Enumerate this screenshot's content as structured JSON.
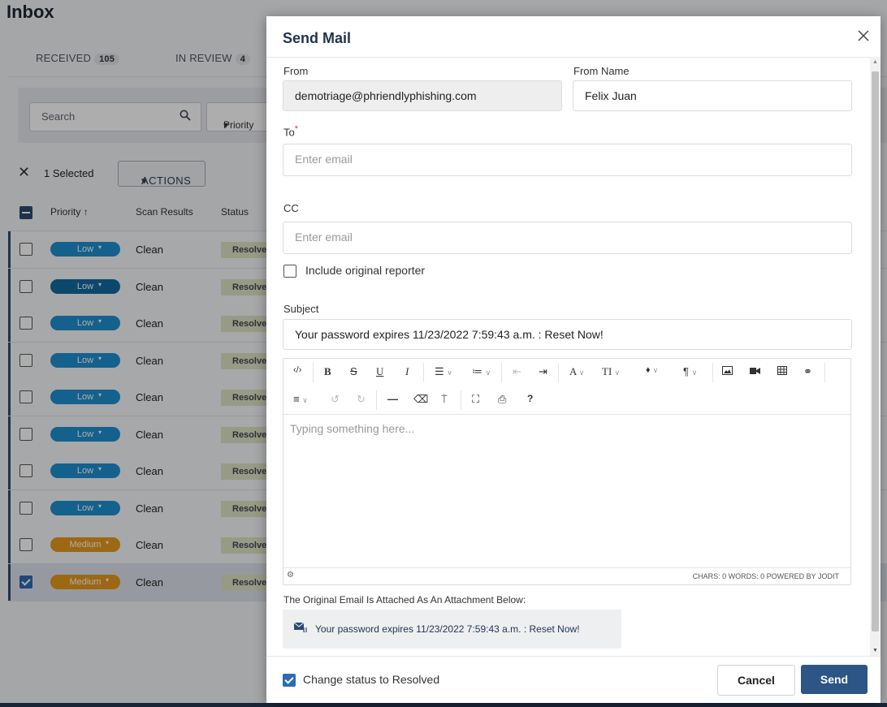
{
  "background": {
    "title": "Inbox",
    "tabs": [
      {
        "label": "RECEIVED",
        "count": "105"
      },
      {
        "label": "IN REVIEW",
        "count": "4"
      }
    ],
    "search_placeholder": "Search",
    "priority_filter": "Priority",
    "selection": {
      "label": "1 Selected",
      "actions": "ACTIONS"
    },
    "columns": [
      "Priority",
      "Scan Results",
      "Status"
    ],
    "rows": [
      {
        "priority": "Low",
        "scan": "Clean",
        "status": "Resolved"
      },
      {
        "priority": "Low",
        "scan": "Clean",
        "status": "Resolved"
      },
      {
        "priority": "Low",
        "scan": "Clean",
        "status": "Resolved"
      },
      {
        "priority": "Low",
        "scan": "Clean",
        "status": "Resolved"
      },
      {
        "priority": "Low",
        "scan": "Clean",
        "status": "Resolved"
      },
      {
        "priority": "Low",
        "scan": "Clean",
        "status": "Resolved"
      },
      {
        "priority": "Low",
        "scan": "Clean",
        "status": "Resolved"
      },
      {
        "priority": "Low",
        "scan": "Clean",
        "status": "Resolved"
      },
      {
        "priority": "Medium",
        "scan": "Clean",
        "status": "Resolved"
      },
      {
        "priority": "Medium",
        "scan": "Clean",
        "status": "Resolved"
      }
    ]
  },
  "modal": {
    "title": "Send Mail",
    "from_label": "From",
    "from_value": "demotriage@phriendlyphishing.com",
    "from_name_label": "From Name",
    "from_name_value": "Felix Juan",
    "to_label": "To",
    "to_required": "*",
    "to_placeholder": "Enter email",
    "cc_label": "CC",
    "cc_placeholder": "Enter email",
    "include_reporter_label": "Include original reporter",
    "subject_label": "Subject",
    "subject_value": "Your password expires 11/23/2022 7:59:43 a.m. : Reset Now!",
    "editor_placeholder": "Typing something here...",
    "editor_stats": "CHARS: 0   WORDS: 0   POWERED BY JODIT",
    "attachment_note": "The Original Email Is Attached As An Attachment Below:",
    "attachment_name": "Your password expires 11/23/2022 7:59:43 a.m. : Reset Now!",
    "change_status_label": "Change status to Resolved",
    "cancel_label": "Cancel",
    "send_label": "Send"
  },
  "colors": {
    "primary": "#2d5586",
    "low": "#1f8fd0",
    "medium": "#e69a1c"
  }
}
